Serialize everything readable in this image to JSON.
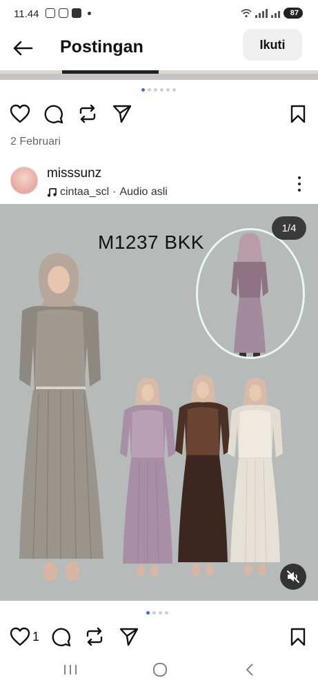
{
  "status_bar": {
    "time": "11.44",
    "battery": "87",
    "icons": [
      "screenshot-icon",
      "instagram-icon",
      "shop-icon",
      "wifi-icon",
      "signal-icon",
      "battery-icon"
    ]
  },
  "header": {
    "title": "Postingan",
    "follow_label": "Ikuti",
    "back_icon": "arrow-left-icon"
  },
  "previous_post": {
    "carousel_pages": 6,
    "active_page": 1,
    "date": "2 Februari"
  },
  "post": {
    "author": "misssunz",
    "audio_artist": "cintaa_scl",
    "audio_separator": "·",
    "audio_label": "Audio asli",
    "image": {
      "product_code": "M1237 BKK",
      "page_counter": "1/4",
      "colors": {
        "background": "#b6bbba",
        "grey_dress": "#8d8880",
        "lilac_dress": "#a98fa5",
        "brown_dress": "#4a3126",
        "cream_dress": "#e3ddd1",
        "highlight_oval": "#e8f7f1"
      }
    },
    "carousel_pages": 4,
    "active_page": 1,
    "like_count": "1"
  },
  "icons": {
    "like": "heart-icon",
    "comment": "comment-icon",
    "repost": "repost-icon",
    "share": "send-icon",
    "save": "bookmark-icon",
    "mute": "muted-speaker-icon",
    "more": "more-vertical-icon",
    "music": "music-note-icon"
  },
  "nav_bar": {
    "items": [
      "recent-apps",
      "home",
      "back"
    ]
  }
}
